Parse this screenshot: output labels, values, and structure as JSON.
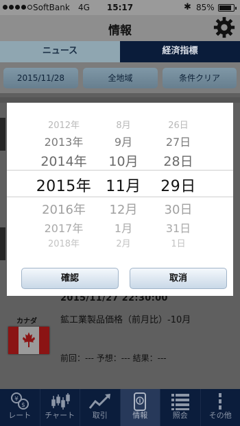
{
  "status_bar": {
    "carrier": "SoftBank",
    "network": "4G",
    "time": "15:17",
    "battery": "85%"
  },
  "header": {
    "title": "情報"
  },
  "tabs": [
    {
      "label": "ニュース",
      "active": false
    },
    {
      "label": "経済指標",
      "active": true
    }
  ],
  "filters": {
    "date": "2015/11/28",
    "region": "全地域",
    "clear": "条件クリア"
  },
  "date_picker": {
    "years": [
      "2012年",
      "2013年",
      "2014年",
      "2015年",
      "2016年",
      "2017年",
      "2018年"
    ],
    "months": [
      "8月",
      "9月",
      "10月",
      "11月",
      "12月",
      "1月",
      "2月"
    ],
    "days": [
      "26日",
      "27日",
      "28日",
      "29日",
      "30日",
      "31日",
      "1日"
    ],
    "selected_year": "2015年",
    "selected_month": "11月",
    "selected_day": "29日",
    "confirm_label": "確認",
    "cancel_label": "取消"
  },
  "event_row": {
    "datetime": "2015/11/27 22:30:00",
    "country": "カナダ",
    "title": "鉱工業製品価格（前月比）-10月",
    "values": "前回：--- 予想：--- 結果：---"
  },
  "bottom_nav": [
    {
      "label": "レート",
      "icon": "rate-icon",
      "active": false
    },
    {
      "label": "チャート",
      "icon": "chart-icon",
      "active": false
    },
    {
      "label": "取引",
      "icon": "trade-icon",
      "active": false
    },
    {
      "label": "情報",
      "icon": "info-icon",
      "active": true
    },
    {
      "label": "照会",
      "icon": "list-icon",
      "active": false
    },
    {
      "label": "その他",
      "icon": "more-icon",
      "active": false
    }
  ]
}
